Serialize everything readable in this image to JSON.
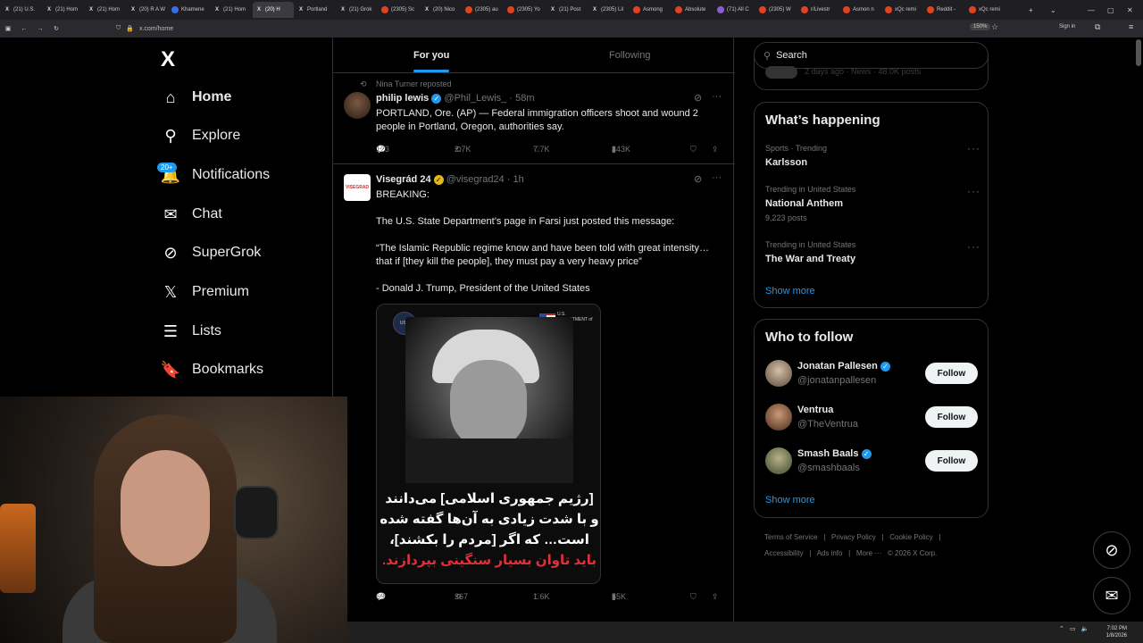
{
  "browser": {
    "tabs": [
      {
        "label": "(21) U.S.",
        "icon": "x"
      },
      {
        "label": "(21) Hom",
        "icon": "x"
      },
      {
        "label": "(21) Hom",
        "icon": "x"
      },
      {
        "label": "(20) R A W",
        "icon": "x"
      },
      {
        "label": "Khamene",
        "icon": "b"
      },
      {
        "label": "(21) Hom",
        "icon": "x"
      },
      {
        "label": "(20) H",
        "icon": "x",
        "active": true
      },
      {
        "label": "Portland",
        "icon": "x"
      },
      {
        "label": "(21) Grok",
        "icon": "x"
      },
      {
        "label": "(2305) Sc",
        "icon": "r"
      },
      {
        "label": "(20) Nico",
        "icon": "x"
      },
      {
        "label": "(2305) au",
        "icon": "r"
      },
      {
        "label": "(2305) Yo",
        "icon": "r"
      },
      {
        "label": "(21) Post",
        "icon": "x"
      },
      {
        "label": "(2305) Lil",
        "icon": "x"
      },
      {
        "label": "Asmong",
        "icon": "r"
      },
      {
        "label": "Absolute",
        "icon": "r"
      },
      {
        "label": "(71) All C",
        "icon": "p"
      },
      {
        "label": "(2305) W",
        "icon": "r"
      },
      {
        "label": "r/Livestr",
        "icon": "r"
      },
      {
        "label": "Asmon n",
        "icon": "r"
      },
      {
        "label": "xQc remi",
        "icon": "r"
      },
      {
        "label": "Reddit -",
        "icon": "r"
      },
      {
        "label": "xQc remi",
        "icon": "r"
      }
    ],
    "new_tab": "+",
    "url": "x.com/home",
    "zoom": "150%",
    "sign_in": "Sign in"
  },
  "nav": {
    "logo": "X",
    "items": [
      {
        "label": "Home",
        "icon": "home-icon",
        "glyph": "⌂",
        "bold": true
      },
      {
        "label": "Explore",
        "icon": "search-icon",
        "glyph": "⚲"
      },
      {
        "label": "Notifications",
        "icon": "bell-icon",
        "glyph": "🔔"
      },
      {
        "label": "Chat",
        "icon": "mail-icon",
        "glyph": "✉"
      },
      {
        "label": "SuperGrok",
        "icon": "grok-icon",
        "glyph": "⊘"
      },
      {
        "label": "Premium",
        "icon": "x-icon",
        "glyph": "𝕏"
      },
      {
        "label": "Lists",
        "icon": "list-icon",
        "glyph": "☰"
      },
      {
        "label": "Bookmarks",
        "icon": "bookmark-icon",
        "glyph": "🔖"
      }
    ],
    "notif_badge": "20+"
  },
  "feed": {
    "tabs": [
      "For you",
      "Following"
    ],
    "tweets": [
      {
        "repost_by": "Nina Turner reposted",
        "name": "philip lewis",
        "verified": "blue",
        "handle": "@Phil_Lewis_",
        "time": "· 58m",
        "text": "PORTLAND, Ore. (AP) — Federal immigration officers shoot and wound 2 people in Portland, Oregon, authorities say.",
        "replies": "123",
        "reposts": "2.7K",
        "likes": "7.7K",
        "views": "343K"
      },
      {
        "name": "Visegrád 24",
        "verified": "gold",
        "handle": "@visegrad24",
        "time": "· 1h",
        "avatar_text": "VISEGRAD",
        "lines": [
          "BREAKING:",
          "The U.S. State Department’s page in Farsi just posted this message:",
          "“The Islamic Republic regime know and have been told with great intensity… that if [they kill the people], they must pay a very heavy price”",
          "- Donald J. Trump, President of the United States"
        ],
        "media": {
          "caption_lines": [
            "[رژیم جمهوری اسلامی] می‌دانند",
            "و با شدت زیادی به آن‌ها گفته شده",
            "است… که اگر [مردم را بکشند]،"
          ],
          "caption_red": "باید تاوان بسیار سنگینی بپردازند.",
          "dept_label": "U.S. DEPARTMENT of STATE",
          "seal_label": "USA"
        },
        "replies": "69",
        "reposts": "367",
        "likes": "1.6K",
        "views": "55K"
      }
    ]
  },
  "sidebar": {
    "search_placeholder": "Search",
    "partial_meta": "2 days ago · News · 48.0K posts",
    "happening_title": "What’s happening",
    "trends": [
      {
        "meta": "Sports · Trending",
        "title": "Karlsson",
        "sub": ""
      },
      {
        "meta": "Trending in United States",
        "title": "National Anthem",
        "sub": "9,223 posts"
      },
      {
        "meta": "Trending in United States",
        "title": "The War and Treaty",
        "sub": ""
      }
    ],
    "show_more": "Show more",
    "who_title": "Who to follow",
    "follow": [
      {
        "name": "Jonatan Pallesen",
        "handle": "@jonatanpallesen",
        "verified": true
      },
      {
        "name": "Ventrua",
        "handle": "@TheVentrua",
        "verified": false
      },
      {
        "name": "Smash Baals",
        "handle": "@smashbaals",
        "verified": true
      }
    ],
    "follow_label": "Follow",
    "footer_row1": [
      "Terms of Service",
      "|",
      "Privacy Policy",
      "|",
      "Cookie Policy",
      "|"
    ],
    "footer_row2": [
      "Accessibility",
      "|",
      "Ads info",
      "|",
      "More ···",
      "© 2026 X Corp."
    ]
  },
  "taskbar": {
    "time": "7:02 PM",
    "date": "1/8/2026"
  },
  "colors": {
    "accent": "#1d9bf0",
    "verified_gold": "#e2b719",
    "muted": "#71767b",
    "border": "#2f3336"
  }
}
